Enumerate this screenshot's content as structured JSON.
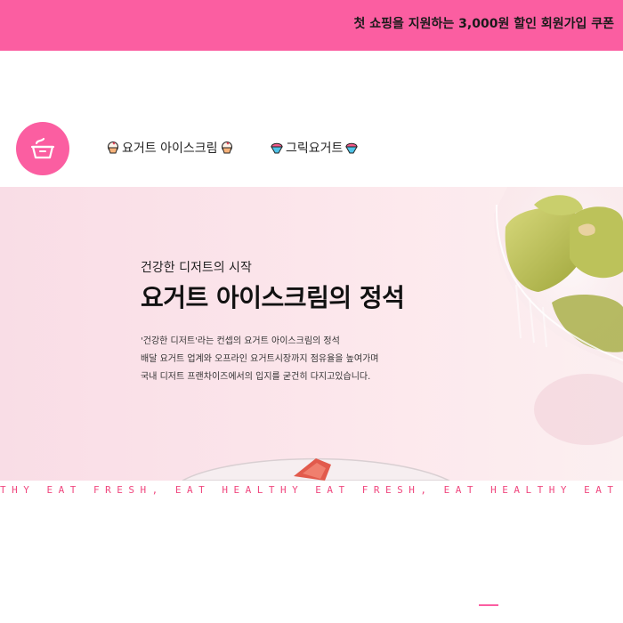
{
  "promo_banner": {
    "text": "첫 쇼핑을 지원하는 3,000원 할인 회원가입 쿠폰"
  },
  "header": {
    "logo_icon": "yogurt-cup-icon",
    "nav": [
      {
        "label": "요거트 아이스크림",
        "icon": "ice-cream-cup-icon"
      },
      {
        "label": "그릭요거트",
        "icon": "shaved-ice-icon"
      }
    ]
  },
  "hero": {
    "subtitle": "건강한 디저트의 시작",
    "title": "요거트 아이스크림의 정석",
    "description_lines": [
      "'건강한 디저트'라는 컨셉의 요거트 아이스크림의 정석",
      "배달 요거트 업계와 오프라인 요거트시장까지 점유율을 높여가며",
      "국내 디저트 프랜차이즈에서의 입지를 굳건히 다지고있습니다."
    ]
  },
  "marquee": {
    "text": "THY EAT FRESH, EAT HEALTHY EAT FRESH, EAT HEALTHY EAT FRESH, EAT HEALTHY"
  },
  "colors": {
    "brand_pink": "#fb5ea1",
    "marquee_text": "#f0487f"
  }
}
